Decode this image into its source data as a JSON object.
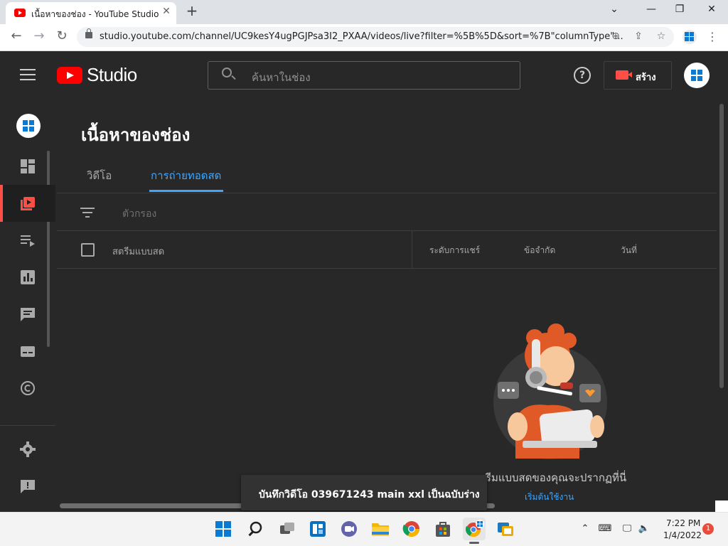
{
  "browser": {
    "tab_title": "เนื้อหาของช่อง - YouTube Studio",
    "url": "studio.youtube.com/channel/UC9kesY4ugPGJPsa3I2_PXAA/videos/live?filter=%5B%5D&sort=%7B\"columnType\"...",
    "tab_close": "✕",
    "new_tab": "+"
  },
  "header": {
    "logo_text": "Studio",
    "search_placeholder": "ค้นหาในช่อง",
    "help": "?",
    "create_label": "สร้าง"
  },
  "main": {
    "page_title": "เนื้อหาของช่อง",
    "tabs": [
      {
        "label": "วิดีโอ",
        "active": false
      },
      {
        "label": "การถ่ายทอดสด",
        "active": true
      }
    ],
    "filter_label": "ตัวกรอง",
    "columns": {
      "live": "สตรีมแบบสด",
      "visibility": "ระดับการแชร์",
      "restrictions": "ข้อจำกัด",
      "date": "วันที่"
    },
    "empty_message": "สตรีมแบบสดของคุณจะปรากฏที่นี่",
    "get_started": "เริ่มต้นใช้งาน"
  },
  "snackbar": {
    "text": "บันทึกวิดีโอ 039671243 main xxl เป็นฉบับร่าง"
  },
  "sidebar": {
    "items": [
      {
        "icon": "dashboard-icon",
        "active": false
      },
      {
        "icon": "content-icon",
        "active": true
      },
      {
        "icon": "playlists-icon",
        "active": false
      },
      {
        "icon": "analytics-icon",
        "active": false
      },
      {
        "icon": "comments-icon",
        "active": false
      },
      {
        "icon": "subtitles-icon",
        "active": false
      },
      {
        "icon": "copyright-icon",
        "active": false
      },
      {
        "icon": "settings-icon",
        "active": false
      },
      {
        "icon": "feedback-icon",
        "active": false
      }
    ]
  },
  "taskbar": {
    "time": "7:22 PM",
    "date": "1/4/2022",
    "notifications": "1"
  },
  "colors": {
    "accent_blue": "#3ea6ff",
    "brand_red": "#ff0000",
    "active_red": "#ff4e45",
    "background": "#282828"
  }
}
